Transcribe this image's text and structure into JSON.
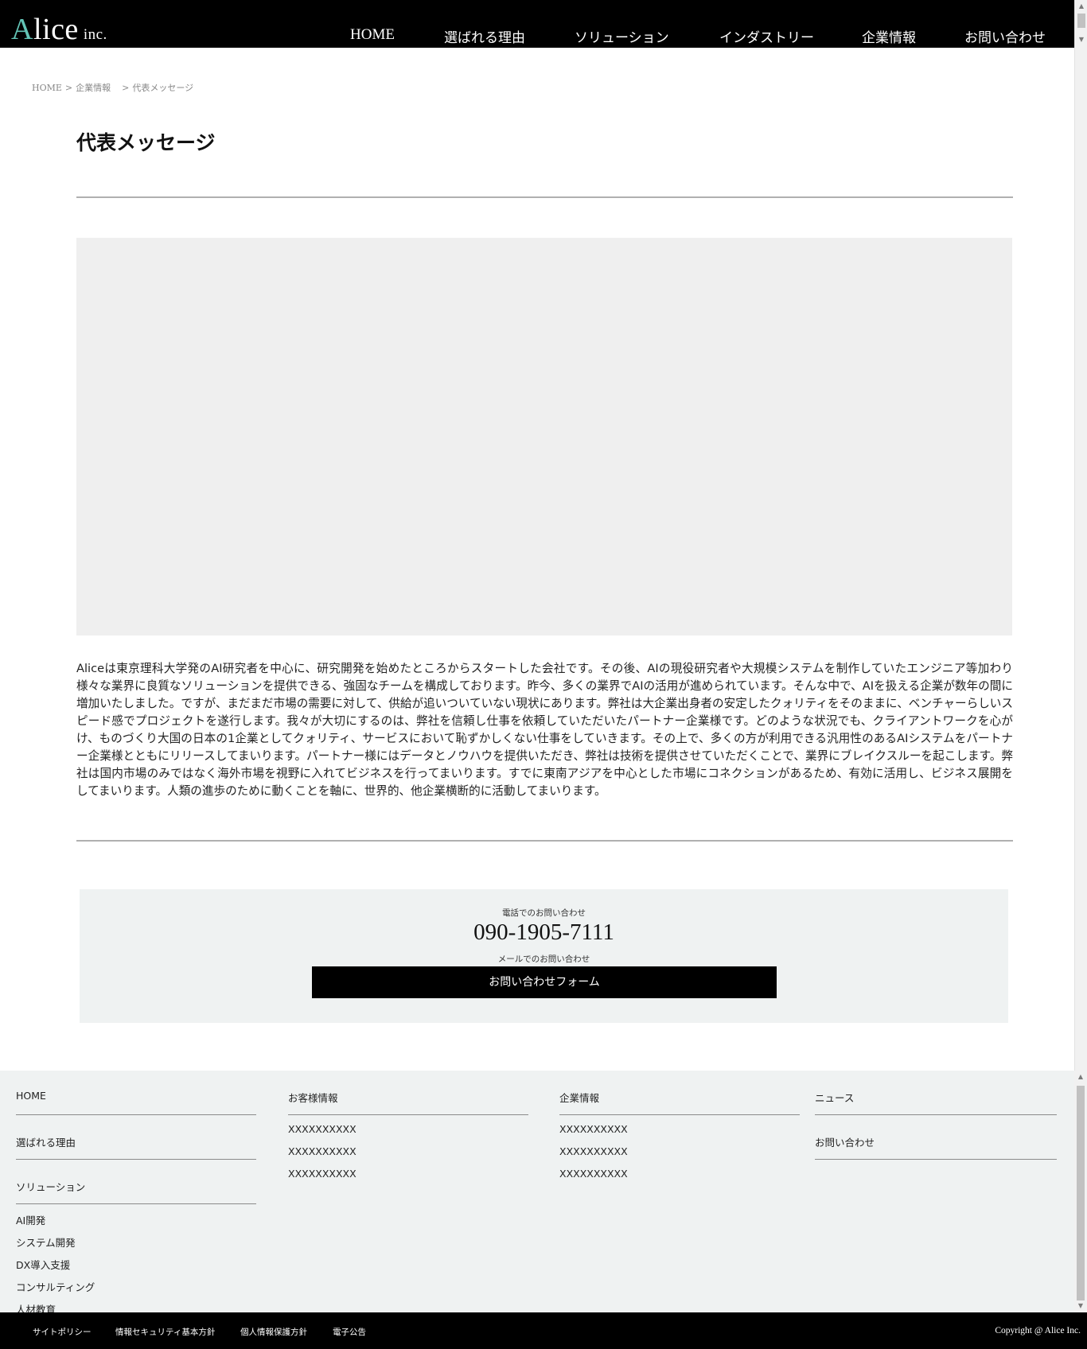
{
  "header": {
    "logo": {
      "initial": "A",
      "rest": "lice",
      "suffix": "inc."
    },
    "nav": [
      {
        "label": "HOME"
      },
      {
        "label": "選ばれる理由"
      },
      {
        "label": "ソリューション"
      },
      {
        "label": "インダストリー"
      },
      {
        "label": "企業情報"
      },
      {
        "label": "お問い合わせ"
      }
    ]
  },
  "breadcrumb": {
    "home": "HOME",
    "sep1": ">",
    "company": "企業情報",
    "sep2": ">",
    "current": "代表メッセージ"
  },
  "page": {
    "title": "代表メッセージ",
    "message": "Aliceは東京理科大学発のAI研究者を中心に、研究開発を始めたところからスタートした会社です。その後、AIの現役研究者や大規模システムを制作していたエンジニア等加わり様々な業界に良質なソリューションを提供できる、強固なチームを構成しております。昨今、多くの業界でAIの活用が進められています。そんな中で、AIを扱える企業が数年の間に増加いたしました。ですが、まだまだ市場の需要に対して、供給が追いついていない現状にあります。弊社は大企業出身者の安定したクォリティをそのままに、ベンチャーらしいスピード感でプロジェクトを遂行します。我々が大切にするのは、弊社を信頼し仕事を依頼していただいたパートナー企業様です。どのような状況でも、クライアントワークを心がけ、ものづくり大国の日本の1企業としてクォリティ、サービスにおいて恥ずかしくない仕事をしていきます。その上で、多くの方が利用できる汎用性のあるAIシステムをパートナー企業様とともにリリースしてまいります。パートナー様にはデータとノウハウを提供いただき、弊社は技術を提供させていただくことで、業界にブレイクスルーを起こします。弊社は国内市場のみではなく海外市場を視野に入れてビジネスを行ってまいります。すでに東南アジアを中心とした市場にコネクションがあるため、有効に活用し、ビジネス展開をしてまいります。人類の進歩のために動くことを軸に、世界的、他企業横断的に活動してまいります。"
  },
  "contact": {
    "phone_label": "電話でのお問い合わせ",
    "phone": "090-1905-7111",
    "mail_label": "メールでのお問い合わせ",
    "form_button": "お問い合わせフォーム"
  },
  "footer": {
    "col1": {
      "home": "HOME",
      "reasons": "選ばれる理由",
      "solutions": "ソリューション",
      "items": [
        "AI開発",
        "システム開発",
        "DX導入支援",
        "コンサルティング",
        "人材教育"
      ]
    },
    "col2": {
      "head": "お客様情報",
      "items": [
        "XXXXXXXXXX",
        "XXXXXXXXXX",
        "XXXXXXXXXX"
      ]
    },
    "col3": {
      "head": "企業情報",
      "items": [
        "XXXXXXXXXX",
        "XXXXXXXXXX",
        "XXXXXXXXXX"
      ]
    },
    "col4": {
      "news": "ニュース",
      "contact": "お問い合わせ"
    }
  },
  "bottom_bar": {
    "links": [
      "サイトポリシー",
      "情報セキュリティ基本方針",
      "個人情報保護方針",
      "電子公告"
    ],
    "copyright": "Copyright @ Alice Inc."
  },
  "icons": {
    "scroll_up": "triangle-up-icon",
    "scroll_down": "triangle-down-icon"
  },
  "colors": {
    "header_bg": "#000000",
    "logo_accent": "#63c4b6",
    "image_placeholder": "#efefef",
    "contact_bg": "#eff2f2",
    "footer_bg": "#eff2f2"
  }
}
